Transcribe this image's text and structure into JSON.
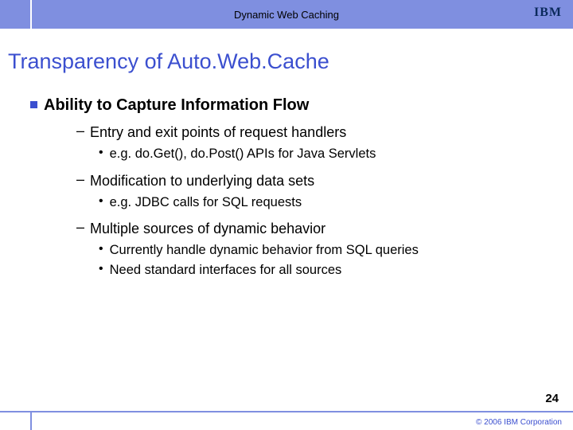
{
  "header": {
    "title": "Dynamic Web Caching",
    "logo_text": "IBM"
  },
  "slide": {
    "title": "Transparency of Auto.Web.Cache",
    "section_heading": "Ability to Capture Information Flow",
    "points": [
      {
        "text": "Entry and exit points of request handlers",
        "sub": [
          "e.g. do.Get(), do.Post() APIs for Java Servlets"
        ]
      },
      {
        "text": "Modification to underlying data sets",
        "sub": [
          "e.g. JDBC calls for SQL requests"
        ]
      },
      {
        "text": "Multiple sources of dynamic behavior",
        "sub": [
          "Currently handle dynamic behavior from SQL queries",
          "Need standard interfaces for all sources"
        ]
      }
    ]
  },
  "footer": {
    "page": "24",
    "copyright": "© 2006 IBM Corporation"
  }
}
